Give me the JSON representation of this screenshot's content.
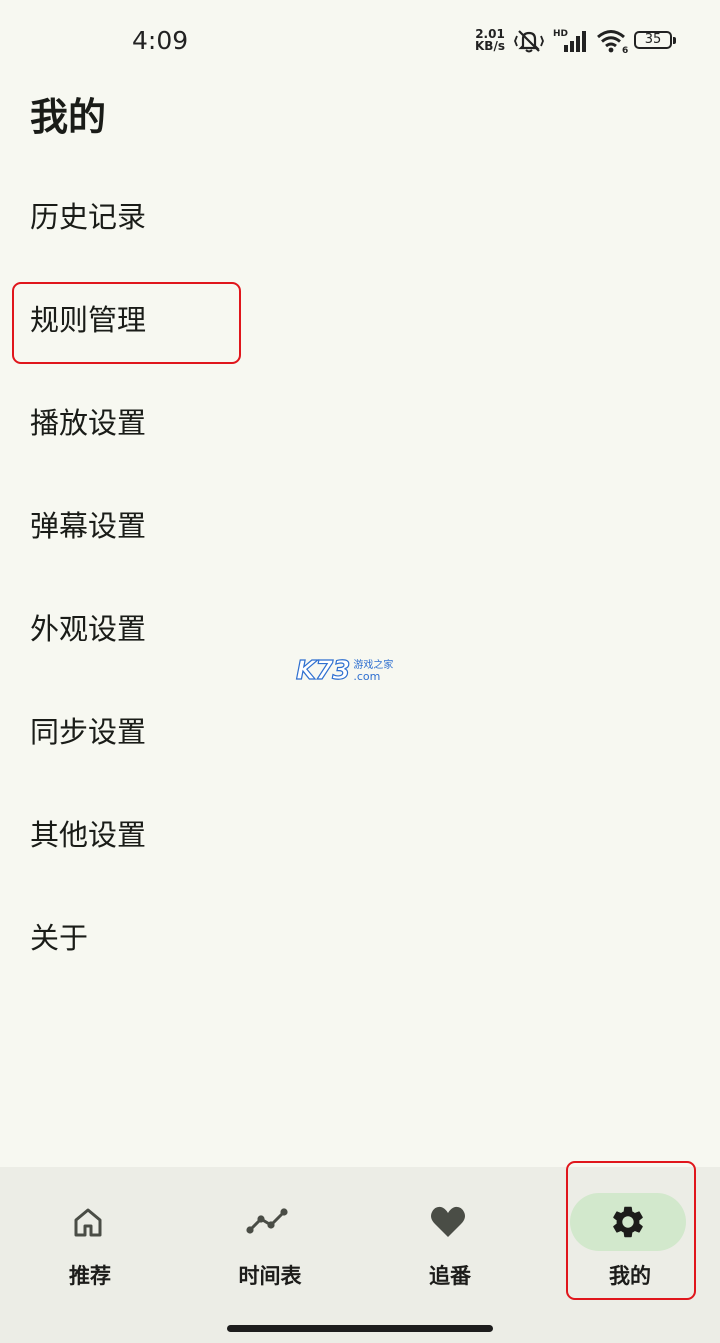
{
  "status_bar": {
    "time": "4:09",
    "net_speed_value": "2.01",
    "net_speed_unit": "KB/s",
    "network_badge": "HD",
    "wifi_badge": "6",
    "battery_level": "35",
    "icons": [
      "mute-vibrate-icon",
      "signal-icon",
      "wifi-icon",
      "battery-icon"
    ]
  },
  "page": {
    "title": "我的"
  },
  "menu": {
    "items": [
      {
        "label": "历史记录"
      },
      {
        "label": "规则管理"
      },
      {
        "label": "播放设置"
      },
      {
        "label": "弹幕设置"
      },
      {
        "label": "外观设置"
      },
      {
        "label": "同步设置"
      },
      {
        "label": "其他设置"
      },
      {
        "label": "关于"
      }
    ]
  },
  "watermark": {
    "logo": "K73",
    "cn": "游戏之家",
    "domain": ".com"
  },
  "bottom_nav": {
    "items": [
      {
        "label": "推荐",
        "icon": "home-icon"
      },
      {
        "label": "时间表",
        "icon": "timeline-icon"
      },
      {
        "label": "追番",
        "icon": "heart-icon"
      },
      {
        "label": "我的",
        "icon": "gear-icon",
        "active": true
      }
    ]
  },
  "colors": {
    "background": "#f7f8f1",
    "nav_background": "#ecede6",
    "active_pill": "#d2e8cc",
    "highlight_border": "#e0161c",
    "text": "#1a1c18"
  }
}
